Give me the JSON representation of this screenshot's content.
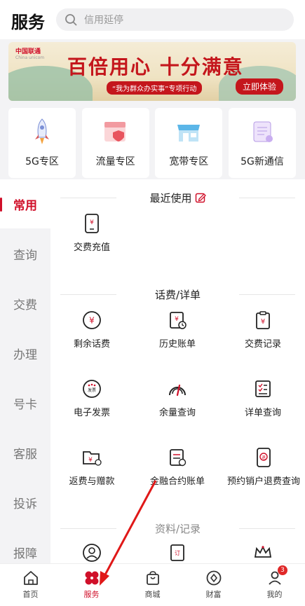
{
  "header": {
    "title": "服务",
    "search_placeholder": "信用延停"
  },
  "banner": {
    "brand": "中国联通",
    "brand_en": "China unicom",
    "headline": "百倍用心 十分满意",
    "tagline": "“我为群众办实事”专项行动",
    "cta": "立即体验"
  },
  "zones": [
    {
      "label": "5G专区"
    },
    {
      "label": "流量专区"
    },
    {
      "label": "宽带专区"
    },
    {
      "label": "5G新通信"
    }
  ],
  "sidebar": [
    {
      "label": "常用"
    },
    {
      "label": "查询"
    },
    {
      "label": "交费"
    },
    {
      "label": "办理"
    },
    {
      "label": "号卡"
    },
    {
      "label": "客服"
    },
    {
      "label": "投诉"
    },
    {
      "label": "报障"
    }
  ],
  "sections": {
    "recent": {
      "title": "最近使用",
      "items": [
        {
          "label": "交费充值",
          "icon": "phone-yen-icon"
        }
      ]
    },
    "bill": {
      "title": "话费/详单",
      "items": [
        {
          "label": "剩余话费",
          "icon": "yen-circle-icon"
        },
        {
          "label": "历史账单",
          "icon": "bill-clock-icon"
        },
        {
          "label": "交费记录",
          "icon": "clipboard-yen-icon"
        },
        {
          "label": "电子发票",
          "icon": "invoice-icon"
        },
        {
          "label": "余量查询",
          "icon": "gauge-icon"
        },
        {
          "label": "详单查询",
          "icon": "checklist-icon"
        },
        {
          "label": "返费与赠款",
          "icon": "folder-yen-icon"
        },
        {
          "label": "金融合约账单",
          "icon": "contract-bill-icon"
        },
        {
          "label": "预约销户退费查询",
          "icon": "phone-refund-icon"
        }
      ]
    },
    "profile": {
      "title": "资料/记录",
      "items": [
        {
          "label": "",
          "icon": "user-icon"
        },
        {
          "label": "",
          "icon": "order-icon"
        },
        {
          "label": "",
          "icon": "crown-icon"
        }
      ]
    }
  },
  "tabbar": [
    {
      "label": "首页"
    },
    {
      "label": "服务"
    },
    {
      "label": "商城"
    },
    {
      "label": "财富"
    },
    {
      "label": "我的",
      "badge": "3"
    }
  ],
  "colors": {
    "accent": "#d0102a"
  }
}
